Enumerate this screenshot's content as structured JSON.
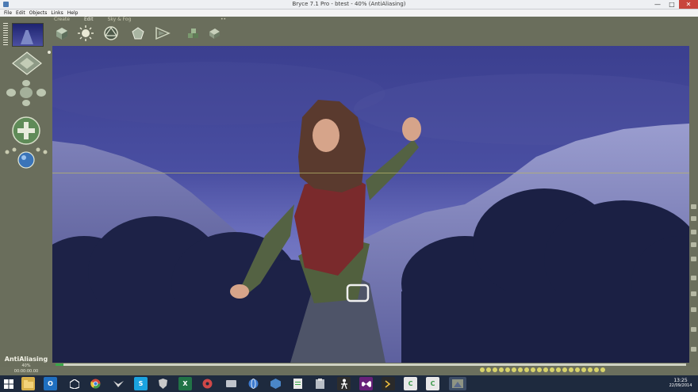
{
  "window": {
    "title": "Bryce 7.1  Pro - btest - 40% (AntiAliasing)",
    "minimize_glyph": "—",
    "maximize_glyph": "□",
    "close_glyph": "✕"
  },
  "menu": [
    "File",
    "Edit",
    "Objects",
    "Links",
    "Help"
  ],
  "toolbar": {
    "tabs": [
      "Create",
      "Edit",
      "Sky & Fog"
    ],
    "active_tab": "Edit",
    "more_glyph": "••"
  },
  "render_status": {
    "name": "AntiAliasing",
    "percent": "40%",
    "time": "00:00:00.00"
  },
  "colors": {
    "chrome": "#6a6e5c",
    "sky": "#3b3f8f",
    "horizon_line": "#b8b56a",
    "taskbar": "#1e2a3e",
    "timeline_progress": "#3aa84a"
  },
  "taskbar": {
    "items": [
      {
        "name": "start",
        "icon": "windows-logo-icon"
      },
      {
        "name": "file-explorer",
        "icon": "folder-icon"
      },
      {
        "name": "outlook",
        "icon": "outlook-icon",
        "label": "O"
      },
      {
        "name": "unity",
        "icon": "unity-icon"
      },
      {
        "name": "chrome",
        "icon": "chrome-icon"
      },
      {
        "name": "app-bird",
        "icon": "bird-icon"
      },
      {
        "name": "skype",
        "icon": "skype-icon",
        "label": "S"
      },
      {
        "name": "app-shield",
        "icon": "shield-icon"
      },
      {
        "name": "excel",
        "icon": "excel-icon",
        "label": "X"
      },
      {
        "name": "app-disc",
        "icon": "disc-icon"
      },
      {
        "name": "app-drive",
        "icon": "drive-icon"
      },
      {
        "name": "app-globe",
        "icon": "globe-icon"
      },
      {
        "name": "app-cube",
        "icon": "cube-icon"
      },
      {
        "name": "app-doc",
        "icon": "document-icon"
      },
      {
        "name": "app-clip",
        "icon": "clipboard-icon"
      },
      {
        "name": "app-figure",
        "icon": "figure-icon"
      },
      {
        "name": "visual-studio",
        "icon": "visual-studio-icon"
      },
      {
        "name": "app-terminal",
        "icon": "terminal-icon"
      },
      {
        "name": "app-c",
        "icon": "c-icon",
        "label": "C"
      },
      {
        "name": "app-c2",
        "icon": "c-icon",
        "label": "C"
      },
      {
        "name": "bryce",
        "icon": "bryce-icon",
        "active": true
      }
    ],
    "clock": {
      "time": "13:25",
      "date": "22/09/2014"
    }
  }
}
